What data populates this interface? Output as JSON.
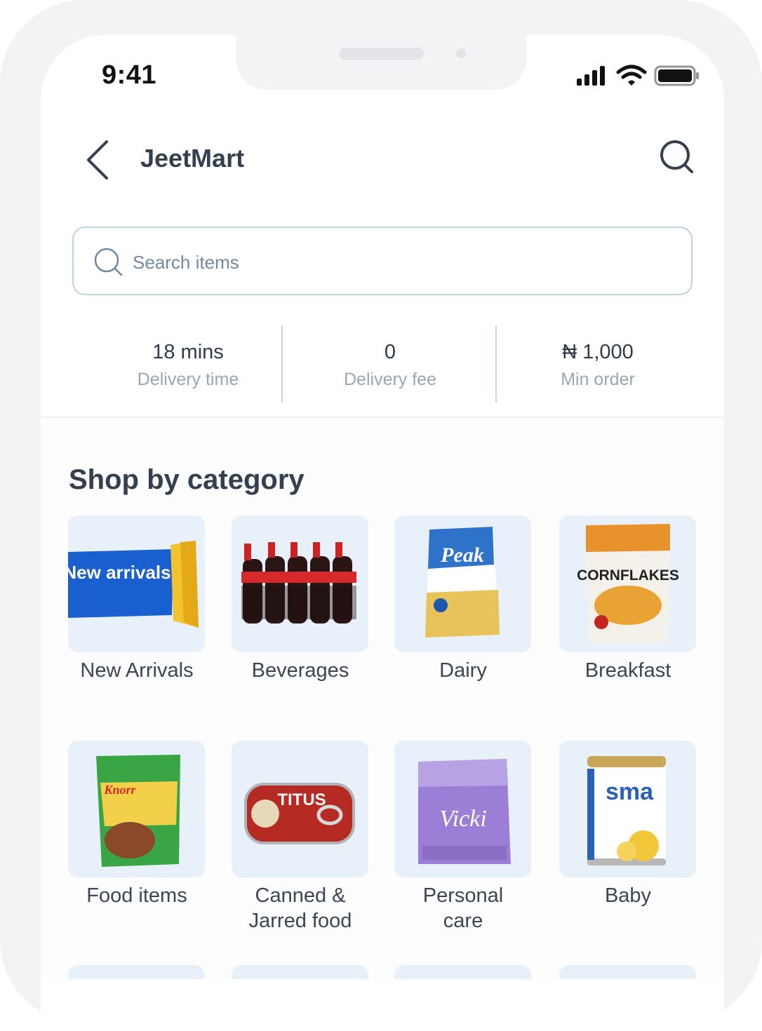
{
  "status_bar": {
    "time": "9:41"
  },
  "header": {
    "title": "JeetMart"
  },
  "search": {
    "placeholder": "Search items"
  },
  "stats": [
    {
      "value": "18 mins",
      "label": "Delivery time"
    },
    {
      "value": "0",
      "label": "Delivery fee"
    },
    {
      "value": "₦ 1,000",
      "label": "Min order"
    }
  ],
  "section": {
    "title": "Shop by category"
  },
  "categories": [
    {
      "label": "New Arrivals",
      "tile_text": "New arrivals"
    },
    {
      "label": "Beverages"
    },
    {
      "label": "Dairy",
      "tile_text": "Peak"
    },
    {
      "label": "Breakfast",
      "tile_text": "CORNFLAKES"
    },
    {
      "label": "Food items",
      "tile_text": "Knorr"
    },
    {
      "label": "Canned & Jarred food",
      "tile_text": "TITUS"
    },
    {
      "label": "Personal care",
      "tile_text": "Vicki"
    },
    {
      "label": "Baby",
      "tile_text": "sma"
    }
  ],
  "colors": {
    "accent_border": "#bcd3e3",
    "tile_bg": "#e8f0fa",
    "text_dark": "#33404f",
    "text_muted": "#9aa6b2"
  }
}
